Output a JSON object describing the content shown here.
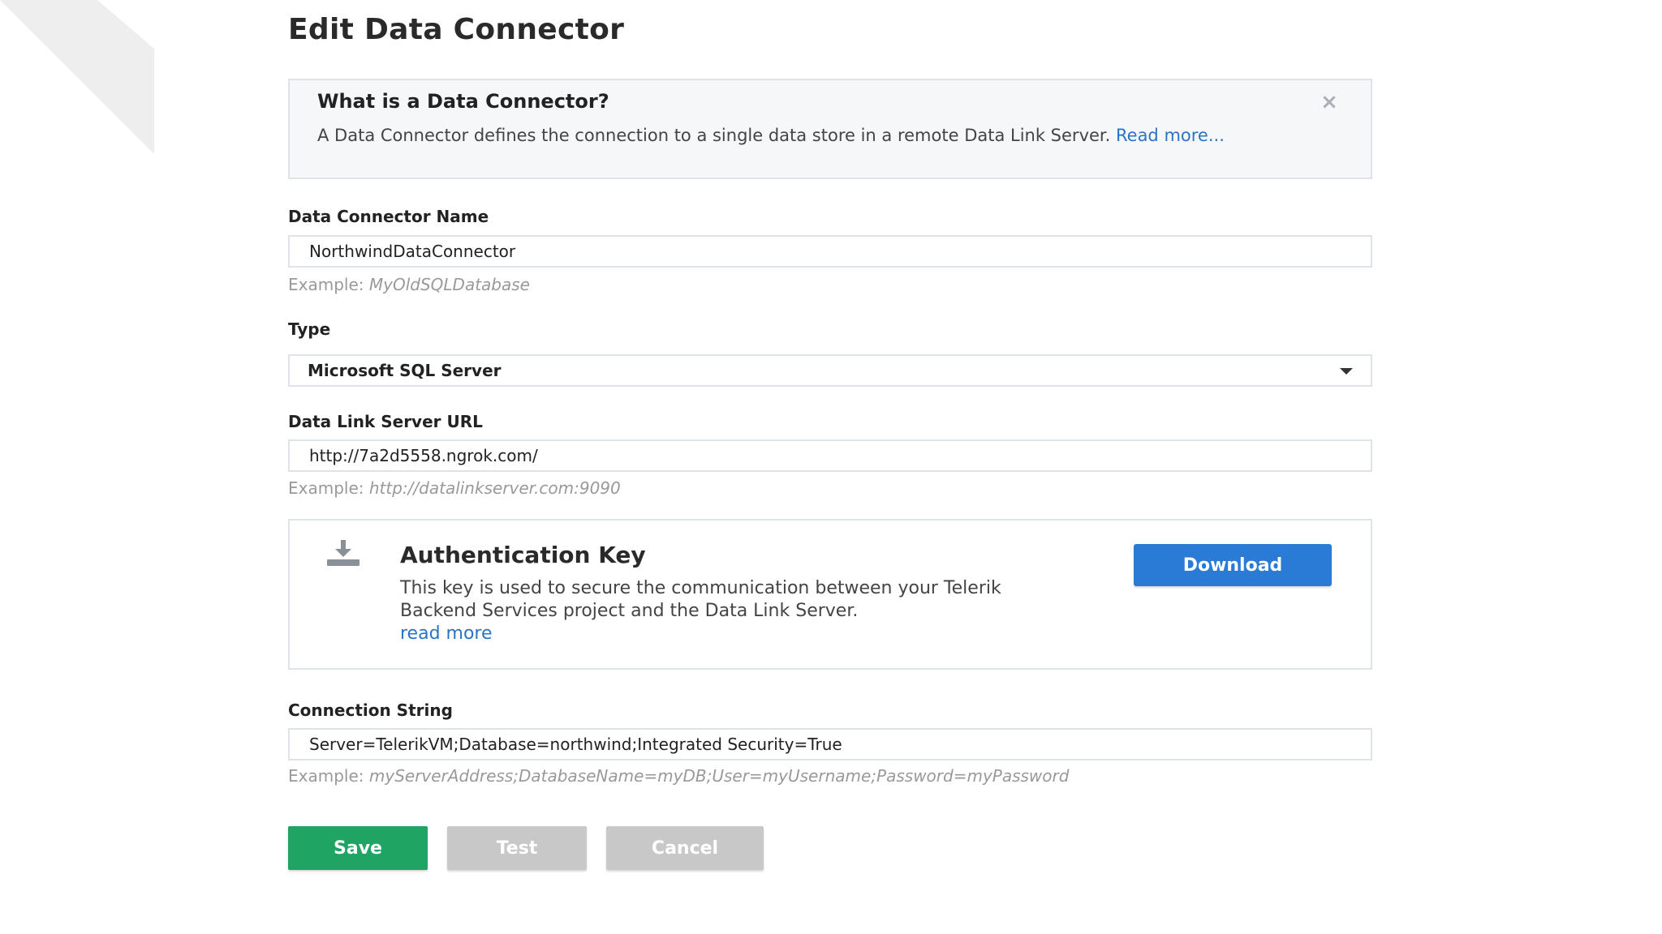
{
  "page": {
    "title": "Edit Data Connector"
  },
  "info": {
    "title": "What is a Data Connector?",
    "text": "A Data Connector defines the connection to a single data store in a remote Data Link Server.",
    "link": "Read more..."
  },
  "fields": {
    "name": {
      "label": "Data Connector Name",
      "value": "NorthwindDataConnector",
      "hint_prefix": "Example:",
      "hint_example": "MyOldSQLDatabase"
    },
    "type": {
      "label": "Type",
      "value": "Microsoft SQL Server"
    },
    "url": {
      "label": "Data Link Server URL",
      "value": "http://7a2d5558.ngrok.com/",
      "hint_prefix": "Example:",
      "hint_example": "http://datalinkserver.com:9090"
    },
    "connection": {
      "label": "Connection String",
      "value": "Server=TelerikVM;Database=northwind;Integrated Security=True",
      "hint_prefix": "Example:",
      "hint_example": "myServerAddress;DatabaseName=myDB;User=myUsername;Password=myPassword"
    }
  },
  "auth": {
    "title": "Authentication Key",
    "text": "This key is used to secure the communication between your Telerik Backend Services project and the Data Link Server.",
    "link": "read more",
    "download_label": "Download"
  },
  "actions": {
    "save_label": "Save",
    "test_label": "Test",
    "cancel_label": "Cancel"
  },
  "colors": {
    "primary": "#2a7bd5",
    "success": "#1fa463",
    "disabled": "#c8c8c8",
    "link": "#2a74c5"
  },
  "icons": [
    "close-icon",
    "download-icon",
    "chevron-down-icon"
  ]
}
